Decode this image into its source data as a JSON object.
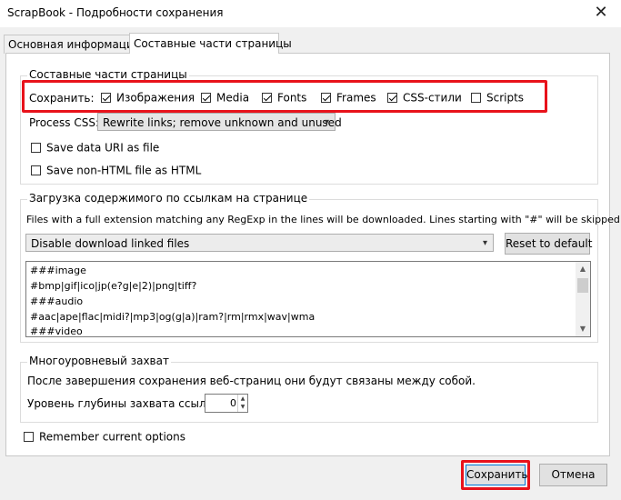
{
  "window": {
    "title": "ScrapBook - Подробности сохранения",
    "close_glyph": "✕"
  },
  "tabs": [
    {
      "label": "Основная информация",
      "active": false
    },
    {
      "label": "Составные части страницы",
      "active": true
    }
  ],
  "components": {
    "legend": "Составные части страницы",
    "save_label": "Сохранить:",
    "items": [
      {
        "label": "Изображения",
        "checked": true
      },
      {
        "label": "Media",
        "checked": true
      },
      {
        "label": "Fonts",
        "checked": true
      },
      {
        "label": "Frames",
        "checked": true
      },
      {
        "label": "CSS-стили",
        "checked": true
      },
      {
        "label": "Scripts",
        "checked": false
      }
    ],
    "process_css_label": "Process CSS:",
    "process_css_value": "Rewrite links; remove unknown and unused",
    "save_data_uri": {
      "label": "Save data URI as file",
      "checked": false
    },
    "save_non_html": {
      "label": "Save non-HTML file as HTML",
      "checked": false
    }
  },
  "linked": {
    "legend": "Загрузка содержимого по ссылкам на странице",
    "description": "Files with a full extension matching any RegExp in the lines will be downloaded. Lines starting with \"#\" will be skipped.",
    "select_value": "Disable download linked files",
    "reset_label": "Reset to default",
    "lines": [
      "###image",
      "#bmp|gif|ico|jp(e?g|e|2)|png|tiff?",
      "###audio",
      "#aac|ape|flac|midi?|mp3|og(g|a)|ram?|rm|rmx|wav|wma",
      "###video"
    ]
  },
  "multilevel": {
    "legend": "Многоуровневый захват",
    "description": "После завершения сохранения веб-страниц они будут связаны между собой.",
    "depth_label": "Уровень глубины захвата ссылок:",
    "depth_value": "0"
  },
  "remember": {
    "label": "Remember current options",
    "checked": false
  },
  "footer": {
    "save_label": "Сохранить",
    "cancel_label": "Отмена"
  },
  "colors": {
    "highlight": "#e8121b"
  }
}
